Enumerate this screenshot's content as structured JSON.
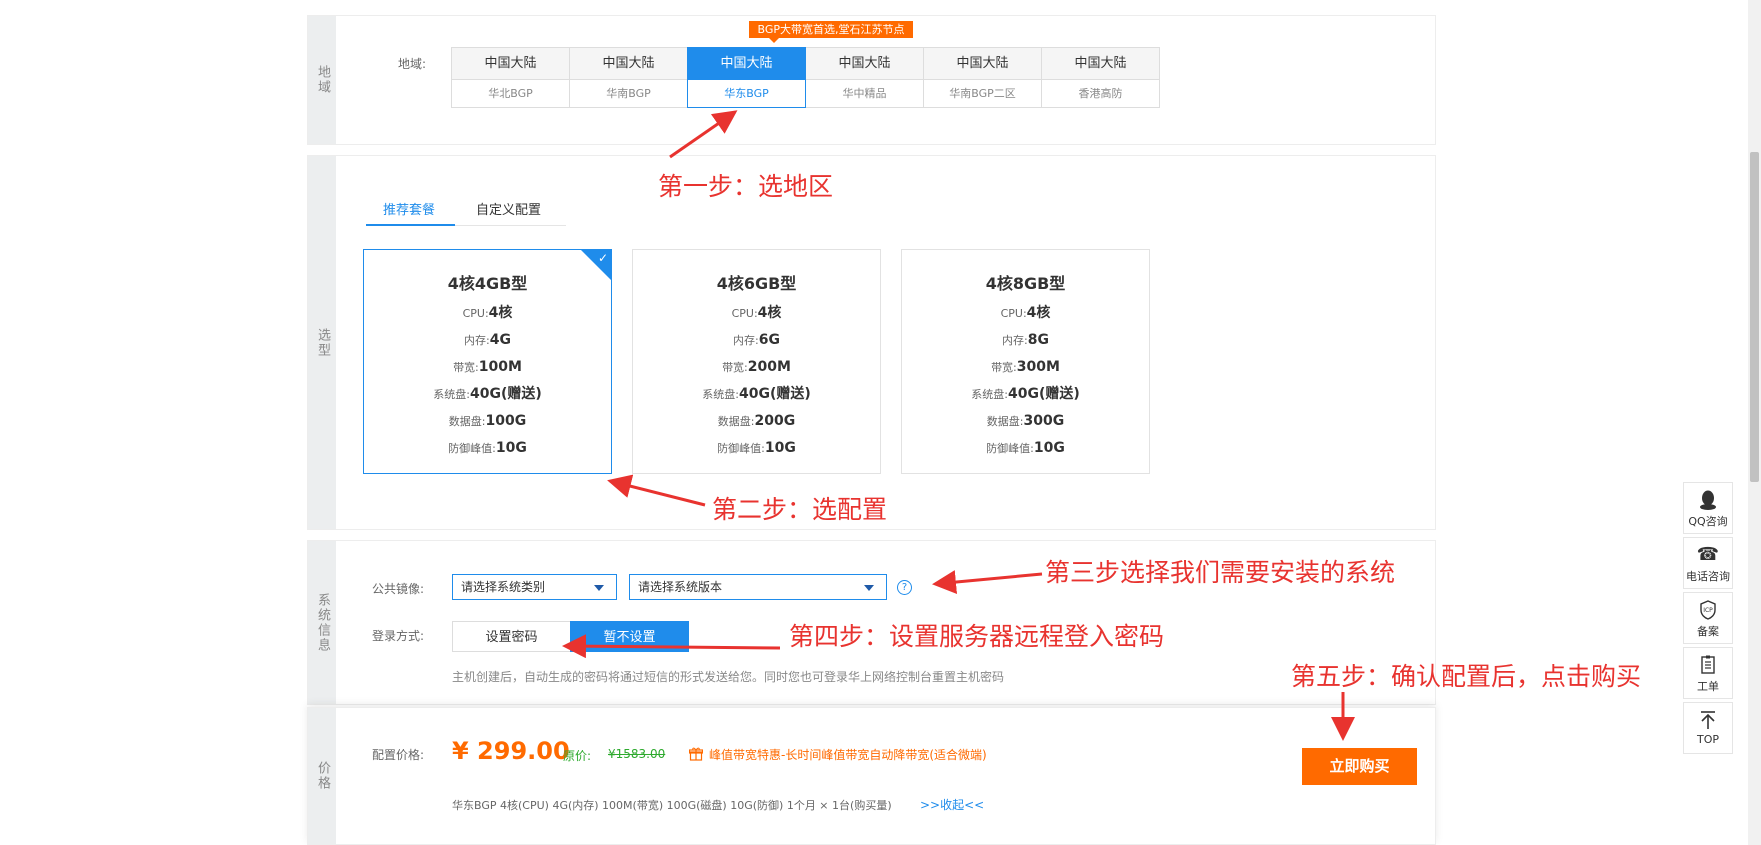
{
  "region_section": {
    "side_label": "地域",
    "row_label": "地域:",
    "promo_tag": "BGP大带宽首选,堂石江苏节点",
    "regions": [
      {
        "top": "中国大陆",
        "bottom": "华北BGP"
      },
      {
        "top": "中国大陆",
        "bottom": "华南BGP"
      },
      {
        "top": "中国大陆",
        "bottom": "华东BGP"
      },
      {
        "top": "中国大陆",
        "bottom": "华中精品"
      },
      {
        "top": "中国大陆",
        "bottom": "华南BGP二区"
      },
      {
        "top": "中国大陆",
        "bottom": "香港高防"
      }
    ],
    "selected_index": 2
  },
  "model_section": {
    "side_label": "选型",
    "tabs": [
      "推荐套餐",
      "自定义配置"
    ],
    "active_tab": 0,
    "packages": [
      {
        "title": "4核4GB型",
        "specs": [
          {
            "k": "CPU:",
            "v": "4核"
          },
          {
            "k": "内存:",
            "v": "4G"
          },
          {
            "k": "带宽:",
            "v": "100M"
          },
          {
            "k": "系统盘:",
            "v": "40G(赠送)"
          },
          {
            "k": "数据盘:",
            "v": "100G"
          },
          {
            "k": "防御峰值:",
            "v": "10G"
          }
        ]
      },
      {
        "title": "4核6GB型",
        "specs": [
          {
            "k": "CPU:",
            "v": "4核"
          },
          {
            "k": "内存:",
            "v": "6G"
          },
          {
            "k": "带宽:",
            "v": "200M"
          },
          {
            "k": "系统盘:",
            "v": "40G(赠送)"
          },
          {
            "k": "数据盘:",
            "v": "200G"
          },
          {
            "k": "防御峰值:",
            "v": "10G"
          }
        ]
      },
      {
        "title": "4核8GB型",
        "specs": [
          {
            "k": "CPU:",
            "v": "4核"
          },
          {
            "k": "内存:",
            "v": "8G"
          },
          {
            "k": "带宽:",
            "v": "300M"
          },
          {
            "k": "系统盘:",
            "v": "40G(赠送)"
          },
          {
            "k": "数据盘:",
            "v": "300G"
          },
          {
            "k": "防御峰值:",
            "v": "10G"
          }
        ]
      }
    ],
    "selected_index": 0
  },
  "system_section": {
    "side_label": "系统信息",
    "image_label": "公共镜像:",
    "os_type_select": "请选择系统类别",
    "os_version_select": "请选择系统版本",
    "help_icon": "?",
    "login_label": "登录方式:",
    "login_options": [
      "设置密码",
      "暂不设置"
    ],
    "login_active": 1,
    "note": "主机创建后，自动生成的密码将通过短信的形式发送给您。同时您也可登录华上网络控制台重置主机密码"
  },
  "price_section": {
    "side_label": "价格",
    "label": "配置价格:",
    "price": "¥ 299.00",
    "orig_label": "原价:",
    "orig_price": "¥1583.00",
    "promo": "峰值带宽特惠-长时间峰值带宽自动降带宽(适合微端)",
    "buy_button": "立即购买",
    "summary": "华东BGP  4核(CPU)  4G(内存)  100M(带宽)  100G(磁盘)  10G(防御)  1个月 × 1台(购买量)",
    "collapse": ">>收起<<"
  },
  "annotations": {
    "step1": "第一步：选地区",
    "step2": "第二步：选配置",
    "step3": "第三步选择我们需要安装的系统",
    "step4": "第四步：设置服务器远程登入密码",
    "step5": "第五步：确认配置后，点击购买"
  },
  "float_bar": [
    {
      "icon": "qq-icon",
      "label": "QQ咨询"
    },
    {
      "icon": "phone-icon",
      "label": "电话咨询"
    },
    {
      "icon": "icp-icon",
      "label": "备案"
    },
    {
      "icon": "ticket-icon",
      "label": "工单"
    },
    {
      "icon": "top-arrow-icon",
      "label": "TOP"
    }
  ],
  "colors": {
    "accent": "#1f8ceb",
    "orange": "#ff6a00",
    "annotation": "#e8332f",
    "green": "#2eaa2e"
  }
}
